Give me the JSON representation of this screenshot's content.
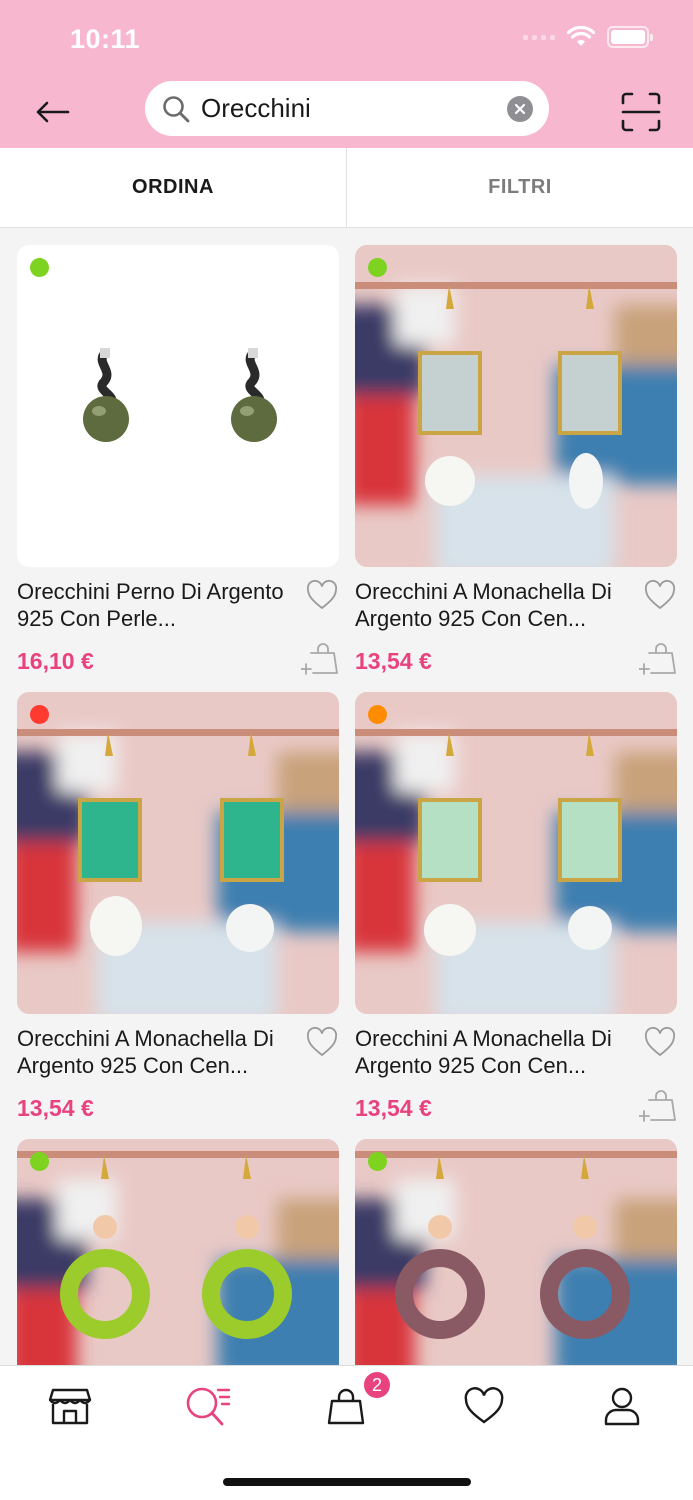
{
  "status_bar": {
    "time": "10:11"
  },
  "header": {
    "search": {
      "value": "Orecchini",
      "placeholder": ""
    }
  },
  "tabs": [
    {
      "label": "ORDINA",
      "active": true
    },
    {
      "label": "FILTRI",
      "active": false
    }
  ],
  "products": [
    {
      "title": "Orecchini Perno Di Argento 925 Con Perle...",
      "price": "16,10 €",
      "availability_color": "#7ed321",
      "image": "black-pearl-earrings"
    },
    {
      "title": "Orecchini A Monachella Di Argento 925 Con Cen...",
      "price": "13,54 €",
      "availability_color": "#7ed321",
      "image": "white-crystal-earrings"
    },
    {
      "title": "Orecchini A Monachella Di Argento 925 Con Cen...",
      "price": "13,54 €",
      "availability_color": "#ff3b30",
      "image": "green-crystal-earrings"
    },
    {
      "title": "Orecchini A Monachella Di Argento 925 Con Cen...",
      "price": "13,54 €",
      "availability_color": "#ff8c00",
      "image": "mint-crystal-earrings"
    },
    {
      "title": "",
      "price": "",
      "availability_color": "#7ed321",
      "image": "lime-hoop-earrings"
    },
    {
      "title": "",
      "price": "",
      "availability_color": "#7ed321",
      "image": "mauve-hoop-earrings"
    }
  ],
  "bottom_nav": {
    "items": [
      {
        "name": "shop",
        "icon": "store-icon",
        "active": false
      },
      {
        "name": "search",
        "icon": "search-list-icon",
        "active": true
      },
      {
        "name": "cart",
        "icon": "bag-icon",
        "active": false,
        "badge": "2"
      },
      {
        "name": "wishlist",
        "icon": "heart-icon",
        "active": false
      },
      {
        "name": "account",
        "icon": "user-icon",
        "active": false
      }
    ]
  },
  "colors": {
    "header_bg": "#f7b8cf",
    "accent": "#e8437f",
    "available": "#7ed321",
    "unavailable": "#ff3b30",
    "limited": "#ff8c00"
  }
}
